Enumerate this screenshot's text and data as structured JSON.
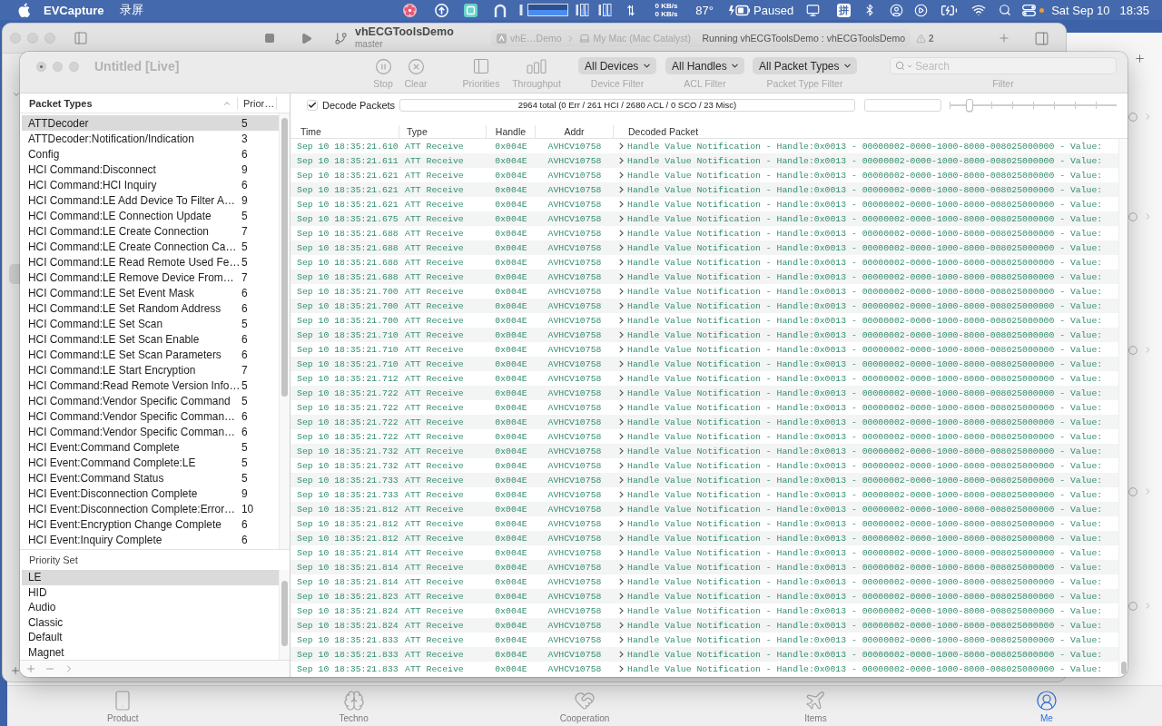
{
  "menu_bar": {
    "app_name": "EVCapture",
    "menus": [
      "录屏"
    ],
    "network_up": "0 KB/s",
    "network_down": "0 KB/s",
    "temperature": "87°",
    "recorder_status": "Paused",
    "input_method": "拼",
    "date": "Sat Sep 10",
    "time": "18:35"
  },
  "xcode_window": {
    "project": "vhECGToolsDemo",
    "branch": "master",
    "scheme": "vhE…Demo",
    "destination": "My Mac (Mac Catalyst)",
    "status": "Running vhECGToolsDemo : vhECGToolsDemo",
    "warnings": "2"
  },
  "packet_logger": {
    "title": "Untitled [Live]",
    "toolbar": {
      "stop": "Stop",
      "clear": "Clear",
      "priorities": "Priorities",
      "throughput": "Throughput"
    },
    "filters": [
      {
        "value": "All Devices",
        "label": "Device Filter"
      },
      {
        "value": "All Handles",
        "label": "ACL Filter"
      },
      {
        "value": "All Packet Types",
        "label": "Packet Type Filter"
      }
    ],
    "search": {
      "placeholder": "Search",
      "label": "Filter"
    },
    "packet_types": {
      "columns": [
        "Packet Types",
        "Prior…"
      ],
      "rows": [
        {
          "name": "ATTDecoder",
          "priority": "5",
          "selected": true
        },
        {
          "name": "ATTDecoder:Notification/Indication",
          "priority": "3",
          "selected": false
        },
        {
          "name": "Config",
          "priority": "6",
          "selected": false
        },
        {
          "name": "HCI Command:Disconnect",
          "priority": "9",
          "selected": false
        },
        {
          "name": "HCI Command:HCI Inquiry",
          "priority": "6",
          "selected": false
        },
        {
          "name": "HCI Command:LE Add Device To Filter A…",
          "priority": "9",
          "selected": false
        },
        {
          "name": "HCI Command:LE Connection Update",
          "priority": "5",
          "selected": false
        },
        {
          "name": "HCI Command:LE Create Connection",
          "priority": "7",
          "selected": false
        },
        {
          "name": "HCI Command:LE Create Connection Ca…",
          "priority": "5",
          "selected": false
        },
        {
          "name": "HCI Command:LE Read Remote Used Fe…",
          "priority": "5",
          "selected": false
        },
        {
          "name": "HCI Command:LE Remove Device From…",
          "priority": "7",
          "selected": false
        },
        {
          "name": "HCI Command:LE Set Event Mask",
          "priority": "6",
          "selected": false
        },
        {
          "name": "HCI Command:LE Set Random Address",
          "priority": "6",
          "selected": false
        },
        {
          "name": "HCI Command:LE Set Scan",
          "priority": "5",
          "selected": false
        },
        {
          "name": "HCI Command:LE Set Scan Enable",
          "priority": "6",
          "selected": false
        },
        {
          "name": "HCI Command:LE Set Scan Parameters",
          "priority": "6",
          "selected": false
        },
        {
          "name": "HCI Command:LE Start Encryption",
          "priority": "7",
          "selected": false
        },
        {
          "name": "HCI Command:Read Remote Version Info…",
          "priority": "5",
          "selected": false
        },
        {
          "name": "HCI Command:Vendor Specific Command",
          "priority": "5",
          "selected": false
        },
        {
          "name": "HCI Command:Vendor Specific Comman…",
          "priority": "6",
          "selected": false
        },
        {
          "name": "HCI Command:Vendor Specific Comman…",
          "priority": "6",
          "selected": false
        },
        {
          "name": "HCI Event:Command Complete",
          "priority": "5",
          "selected": false
        },
        {
          "name": "HCI Event:Command Complete:LE",
          "priority": "5",
          "selected": false
        },
        {
          "name": "HCI Event:Command Status",
          "priority": "5",
          "selected": false
        },
        {
          "name": "HCI Event:Disconnection Complete",
          "priority": "9",
          "selected": false
        },
        {
          "name": "HCI Event:Disconnection Complete:Error…",
          "priority": "10",
          "selected": false
        },
        {
          "name": "HCI Event:Encryption Change Complete",
          "priority": "6",
          "selected": false
        },
        {
          "name": "HCI Event:Inquiry Complete",
          "priority": "6",
          "selected": false
        }
      ]
    },
    "priority_set": {
      "header": "Priority Set",
      "items": [
        {
          "name": "LE",
          "selected": true
        },
        {
          "name": "HID",
          "selected": false
        },
        {
          "name": "Audio",
          "selected": false
        },
        {
          "name": "Classic",
          "selected": false
        },
        {
          "name": "Default",
          "selected": false
        },
        {
          "name": "Magnet",
          "selected": false
        }
      ]
    },
    "decode_packets": {
      "label": "Decode Packets",
      "checked": true
    },
    "summary": "2964 total (0 Err / 261 HCI / 2680 ACL / 0 SCO / 23 Misc)",
    "slider": {
      "level": 0.12
    },
    "table": {
      "columns": [
        "Time",
        "Type",
        "Handle",
        "Addr",
        "Decoded Packet"
      ],
      "rows": [
        {
          "time": "Sep 10 18:35:21.610",
          "type": "ATT Receive",
          "handle": "0x004E",
          "addr": "AVHCV10758",
          "packet": "Handle Value Notification - Handle:0x0013 - 00000002-0000-1000-8000-008025000000 - Value:"
        },
        {
          "time": "Sep 10 18:35:21.611",
          "type": "ATT Receive",
          "handle": "0x004E",
          "addr": "AVHCV10758",
          "packet": "Handle Value Notification - Handle:0x0013 - 00000002-0000-1000-8000-008025000000 - Value:"
        },
        {
          "time": "Sep 10 18:35:21.621",
          "type": "ATT Receive",
          "handle": "0x004E",
          "addr": "AVHCV10758",
          "packet": "Handle Value Notification - Handle:0x0013 - 00000002-0000-1000-8000-008025000000 - Value:"
        },
        {
          "time": "Sep 10 18:35:21.621",
          "type": "ATT Receive",
          "handle": "0x004E",
          "addr": "AVHCV10758",
          "packet": "Handle Value Notification - Handle:0x0013 - 00000002-0000-1000-8000-008025000000 - Value:"
        },
        {
          "time": "Sep 10 18:35:21.621",
          "type": "ATT Receive",
          "handle": "0x004E",
          "addr": "AVHCV10758",
          "packet": "Handle Value Notification - Handle:0x0013 - 00000002-0000-1000-8000-008025000000 - Value:"
        },
        {
          "time": "Sep 10 18:35:21.675",
          "type": "ATT Receive",
          "handle": "0x004E",
          "addr": "AVHCV10758",
          "packet": "Handle Value Notification - Handle:0x0013 - 00000002-0000-1000-8000-008025000000 - Value:"
        },
        {
          "time": "Sep 10 18:35:21.688",
          "type": "ATT Receive",
          "handle": "0x004E",
          "addr": "AVHCV10758",
          "packet": "Handle Value Notification - Handle:0x0013 - 00000002-0000-1000-8000-008025000000 - Value:"
        },
        {
          "time": "Sep 10 18:35:21.688",
          "type": "ATT Receive",
          "handle": "0x004E",
          "addr": "AVHCV10758",
          "packet": "Handle Value Notification - Handle:0x0013 - 00000002-0000-1000-8000-008025000000 - Value:"
        },
        {
          "time": "Sep 10 18:35:21.688",
          "type": "ATT Receive",
          "handle": "0x004E",
          "addr": "AVHCV10758",
          "packet": "Handle Value Notification - Handle:0x0013 - 00000002-0000-1000-8000-008025000000 - Value:"
        },
        {
          "time": "Sep 10 18:35:21.688",
          "type": "ATT Receive",
          "handle": "0x004E",
          "addr": "AVHCV10758",
          "packet": "Handle Value Notification - Handle:0x0013 - 00000002-0000-1000-8000-008025000000 - Value:"
        },
        {
          "time": "Sep 10 18:35:21.700",
          "type": "ATT Receive",
          "handle": "0x004E",
          "addr": "AVHCV10758",
          "packet": "Handle Value Notification - Handle:0x0013 - 00000002-0000-1000-8000-008025000000 - Value:"
        },
        {
          "time": "Sep 10 18:35:21.700",
          "type": "ATT Receive",
          "handle": "0x004E",
          "addr": "AVHCV10758",
          "packet": "Handle Value Notification - Handle:0x0013 - 00000002-0000-1000-8000-008025000000 - Value:"
        },
        {
          "time": "Sep 10 18:35:21.700",
          "type": "ATT Receive",
          "handle": "0x004E",
          "addr": "AVHCV10758",
          "packet": "Handle Value Notification - Handle:0x0013 - 00000002-0000-1000-8000-008025000000 - Value:"
        },
        {
          "time": "Sep 10 18:35:21.710",
          "type": "ATT Receive",
          "handle": "0x004E",
          "addr": "AVHCV10758",
          "packet": "Handle Value Notification - Handle:0x0013 - 00000002-0000-1000-8000-008025000000 - Value:"
        },
        {
          "time": "Sep 10 18:35:21.710",
          "type": "ATT Receive",
          "handle": "0x004E",
          "addr": "AVHCV10758",
          "packet": "Handle Value Notification - Handle:0x0013 - 00000002-0000-1000-8000-008025000000 - Value:"
        },
        {
          "time": "Sep 10 18:35:21.710",
          "type": "ATT Receive",
          "handle": "0x004E",
          "addr": "AVHCV10758",
          "packet": "Handle Value Notification - Handle:0x0013 - 00000002-0000-1000-8000-008025000000 - Value:"
        },
        {
          "time": "Sep 10 18:35:21.712",
          "type": "ATT Receive",
          "handle": "0x004E",
          "addr": "AVHCV10758",
          "packet": "Handle Value Notification - Handle:0x0013 - 00000002-0000-1000-8000-008025000000 - Value:"
        },
        {
          "time": "Sep 10 18:35:21.722",
          "type": "ATT Receive",
          "handle": "0x004E",
          "addr": "AVHCV10758",
          "packet": "Handle Value Notification - Handle:0x0013 - 00000002-0000-1000-8000-008025000000 - Value:"
        },
        {
          "time": "Sep 10 18:35:21.722",
          "type": "ATT Receive",
          "handle": "0x004E",
          "addr": "AVHCV10758",
          "packet": "Handle Value Notification - Handle:0x0013 - 00000002-0000-1000-8000-008025000000 - Value:"
        },
        {
          "time": "Sep 10 18:35:21.722",
          "type": "ATT Receive",
          "handle": "0x004E",
          "addr": "AVHCV10758",
          "packet": "Handle Value Notification - Handle:0x0013 - 00000002-0000-1000-8000-008025000000 - Value:"
        },
        {
          "time": "Sep 10 18:35:21.722",
          "type": "ATT Receive",
          "handle": "0x004E",
          "addr": "AVHCV10758",
          "packet": "Handle Value Notification - Handle:0x0013 - 00000002-0000-1000-8000-008025000000 - Value:"
        },
        {
          "time": "Sep 10 18:35:21.732",
          "type": "ATT Receive",
          "handle": "0x004E",
          "addr": "AVHCV10758",
          "packet": "Handle Value Notification - Handle:0x0013 - 00000002-0000-1000-8000-008025000000 - Value:"
        },
        {
          "time": "Sep 10 18:35:21.732",
          "type": "ATT Receive",
          "handle": "0x004E",
          "addr": "AVHCV10758",
          "packet": "Handle Value Notification - Handle:0x0013 - 00000002-0000-1000-8000-008025000000 - Value:"
        },
        {
          "time": "Sep 10 18:35:21.733",
          "type": "ATT Receive",
          "handle": "0x004E",
          "addr": "AVHCV10758",
          "packet": "Handle Value Notification - Handle:0x0013 - 00000002-0000-1000-8000-008025000000 - Value:"
        },
        {
          "time": "Sep 10 18:35:21.733",
          "type": "ATT Receive",
          "handle": "0x004E",
          "addr": "AVHCV10758",
          "packet": "Handle Value Notification - Handle:0x0013 - 00000002-0000-1000-8000-008025000000 - Value:"
        },
        {
          "time": "Sep 10 18:35:21.812",
          "type": "ATT Receive",
          "handle": "0x004E",
          "addr": "AVHCV10758",
          "packet": "Handle Value Notification - Handle:0x0013 - 00000002-0000-1000-8000-008025000000 - Value:"
        },
        {
          "time": "Sep 10 18:35:21.812",
          "type": "ATT Receive",
          "handle": "0x004E",
          "addr": "AVHCV10758",
          "packet": "Handle Value Notification - Handle:0x0013 - 00000002-0000-1000-8000-008025000000 - Value:"
        },
        {
          "time": "Sep 10 18:35:21.812",
          "type": "ATT Receive",
          "handle": "0x004E",
          "addr": "AVHCV10758",
          "packet": "Handle Value Notification - Handle:0x0013 - 00000002-0000-1000-8000-008025000000 - Value:"
        },
        {
          "time": "Sep 10 18:35:21.814",
          "type": "ATT Receive",
          "handle": "0x004E",
          "addr": "AVHCV10758",
          "packet": "Handle Value Notification - Handle:0x0013 - 00000002-0000-1000-8000-008025000000 - Value:"
        },
        {
          "time": "Sep 10 18:35:21.814",
          "type": "ATT Receive",
          "handle": "0x004E",
          "addr": "AVHCV10758",
          "packet": "Handle Value Notification - Handle:0x0013 - 00000002-0000-1000-8000-008025000000 - Value:"
        },
        {
          "time": "Sep 10 18:35:21.814",
          "type": "ATT Receive",
          "handle": "0x004E",
          "addr": "AVHCV10758",
          "packet": "Handle Value Notification - Handle:0x0013 - 00000002-0000-1000-8000-008025000000 - Value:"
        },
        {
          "time": "Sep 10 18:35:21.823",
          "type": "ATT Receive",
          "handle": "0x004E",
          "addr": "AVHCV10758",
          "packet": "Handle Value Notification - Handle:0x0013 - 00000002-0000-1000-8000-008025000000 - Value:"
        },
        {
          "time": "Sep 10 18:35:21.824",
          "type": "ATT Receive",
          "handle": "0x004E",
          "addr": "AVHCV10758",
          "packet": "Handle Value Notification - Handle:0x0013 - 00000002-0000-1000-8000-008025000000 - Value:"
        },
        {
          "time": "Sep 10 18:35:21.824",
          "type": "ATT Receive",
          "handle": "0x004E",
          "addr": "AVHCV10758",
          "packet": "Handle Value Notification - Handle:0x0013 - 00000002-0000-1000-8000-008025000000 - Value:"
        },
        {
          "time": "Sep 10 18:35:21.833",
          "type": "ATT Receive",
          "handle": "0x004E",
          "addr": "AVHCV10758",
          "packet": "Handle Value Notification - Handle:0x0013 - 00000002-0000-1000-8000-008025000000 - Value:"
        },
        {
          "time": "Sep 10 18:35:21.833",
          "type": "ATT Receive",
          "handle": "0x004E",
          "addr": "AVHCV10758",
          "packet": "Handle Value Notification - Handle:0x0013 - 00000002-0000-1000-8000-008025000000 - Value:"
        },
        {
          "time": "Sep 10 18:35:21.833",
          "type": "ATT Receive",
          "handle": "0x004E",
          "addr": "AVHCV10758",
          "packet": "Handle Value Notification - Handle:0x0013 - 00000002-0000-1000-8000-008025000000 - Value:"
        }
      ]
    }
  },
  "background_app": {
    "tabs": [
      {
        "label": "Product",
        "selected": false
      },
      {
        "label": "Techno",
        "selected": false
      },
      {
        "label": "Cooperation",
        "selected": false
      },
      {
        "label": "Items",
        "selected": false
      },
      {
        "label": "Me",
        "selected": true
      }
    ]
  }
}
